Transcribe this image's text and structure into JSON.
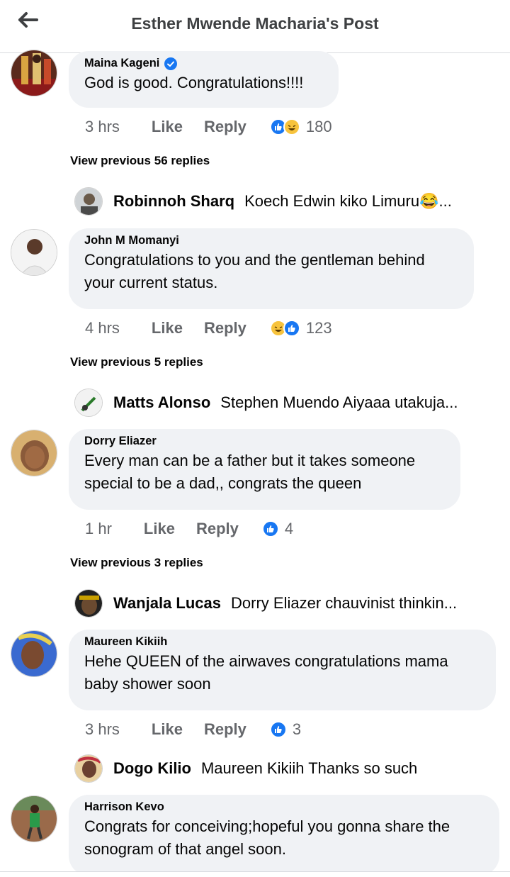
{
  "header": {
    "title": "Esther Mwende Macharia's Post"
  },
  "comments": [
    {
      "author": "Maina Kageni",
      "verified": true,
      "text": "God is good. Congratulations!!!!",
      "time": "3 hrs",
      "like_label": "Like",
      "reply_label": "Reply",
      "reactions": [
        "like",
        "haha"
      ],
      "reaction_count": "180",
      "view_previous": "View previous 56 replies",
      "reply_preview": {
        "author": "Robinnoh Sharq",
        "text": "Koech Edwin kiko Limuru😂..."
      }
    },
    {
      "author": "John M Momanyi",
      "text_lines": [
        "Congratulations to you and the gentleman behind",
        "your current status."
      ],
      "time": "4 hrs",
      "like_label": "Like",
      "reply_label": "Reply",
      "reactions": [
        "haha",
        "like"
      ],
      "reaction_count": "123",
      "view_previous": "View previous 5 replies",
      "reply_preview": {
        "author": "Matts Alonso",
        "text": "Stephen Muendo Aiyaaa utakuja..."
      }
    },
    {
      "author": "Dorry Eliazer",
      "text_lines": [
        "Every man can be a father but it takes someone",
        "special to be a dad,, congrats the queen"
      ],
      "time": "1 hr",
      "like_label": "Like",
      "reply_label": "Reply",
      "reactions": [
        "like"
      ],
      "reaction_count": "4",
      "view_previous": "View previous 3 replies",
      "reply_preview": {
        "author": "Wanjala Lucas",
        "text": "Dorry Eliazer chauvinist thinkin..."
      }
    },
    {
      "author": "Maureen Kikiih",
      "text_lines": [
        "Hehe QUEEN of the airwaves congratulations mama",
        "baby shower soon"
      ],
      "time": "3 hrs",
      "like_label": "Like",
      "reply_label": "Reply",
      "reactions": [
        "like"
      ],
      "reaction_count": "3",
      "reply_preview": {
        "author": "Dogo Kilio",
        "text": "Maureen Kikiih Thanks  so  such"
      }
    },
    {
      "author": "Harrison Kevo",
      "text_lines": [
        "Congrats for conceiving;hopeful you gonna share the",
        "sonogram of that angel soon."
      ]
    }
  ],
  "colors": {
    "accent": "#1877f2",
    "bubble": "#f0f2f5",
    "muted": "#65676b",
    "haha": "#f7c33d"
  },
  "icons": [
    "back-arrow-icon",
    "verified-badge-icon",
    "like-reaction-icon",
    "haha-reaction-icon"
  ]
}
